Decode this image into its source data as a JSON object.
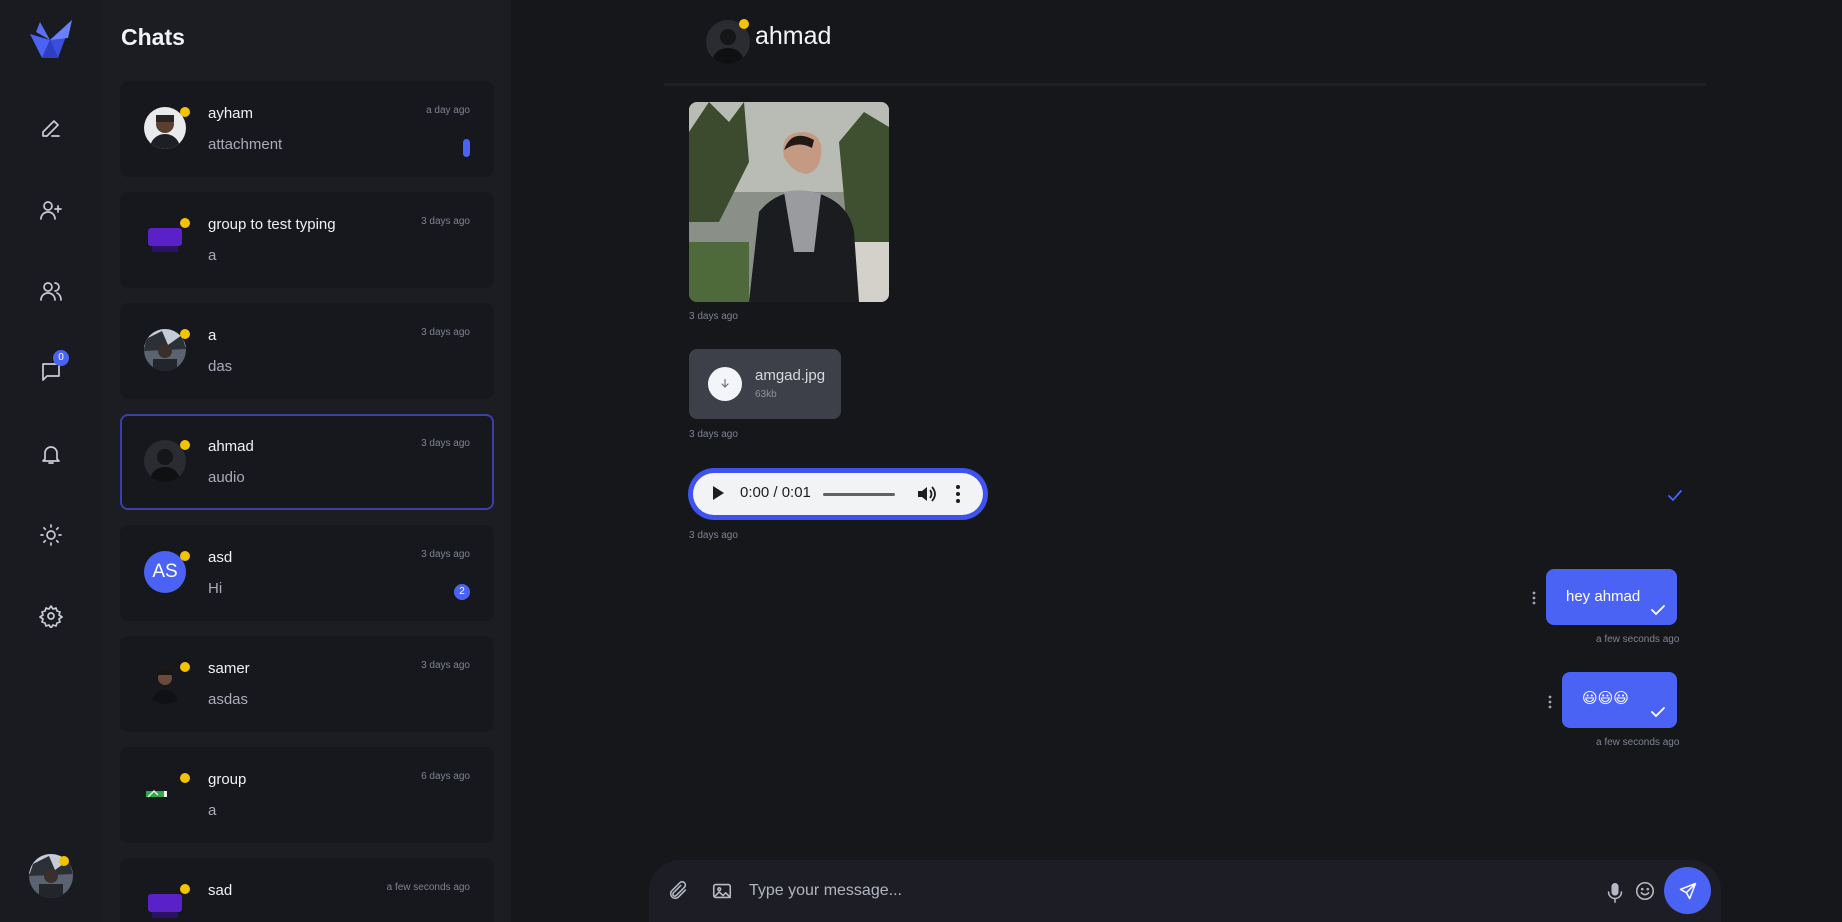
{
  "sidebar_title": "Chats",
  "nav": {
    "messages_badge": "0"
  },
  "chats": [
    {
      "name": "ayham",
      "preview": "attachment",
      "time": "a day ago"
    },
    {
      "name": "group to test typing",
      "preview": "a",
      "time": "3 days ago"
    },
    {
      "name": "a",
      "preview": "das",
      "time": "3 days ago"
    },
    {
      "name": "ahmad",
      "preview": "audio",
      "time": "3 days ago"
    },
    {
      "name": "asd",
      "preview": "Hi",
      "time": "3 days ago",
      "initials": "AS",
      "unread": "2"
    },
    {
      "name": "samer",
      "preview": "asdas",
      "time": "3 days ago"
    },
    {
      "name": "group",
      "preview": "a",
      "time": "6 days ago"
    },
    {
      "name": "sad",
      "preview": "",
      "time": "a few seconds ago"
    }
  ],
  "conversation": {
    "contact_name": "ahmad",
    "messages": [
      {
        "type": "image",
        "time": "3 days ago"
      },
      {
        "type": "file",
        "file_name": "amgad.jpg",
        "file_size": "63kb",
        "time": "3 days ago"
      },
      {
        "type": "audio",
        "audio_time": "0:00 / 0:01",
        "time": "3 days ago"
      },
      {
        "type": "text",
        "text": "hey ahmad",
        "time": "a few seconds ago"
      },
      {
        "type": "text",
        "text": "😃😃😃",
        "time": "a few seconds ago"
      }
    ]
  },
  "composer": {
    "placeholder": "Type your message..."
  },
  "colors": {
    "accent": "#4b63f5",
    "online": "#f5c400",
    "background": "#16171b",
    "panel": "#1c1d23"
  },
  "icons": [
    "logo-icon",
    "pencil-icon",
    "add-user-icon",
    "users-icon",
    "chat-icon",
    "bell-icon",
    "sun-icon",
    "gear-icon",
    "paperclip-icon",
    "image-icon",
    "microphone-icon",
    "smiley-icon",
    "send-icon",
    "download-icon",
    "check-icon",
    "kebab-icon"
  ]
}
